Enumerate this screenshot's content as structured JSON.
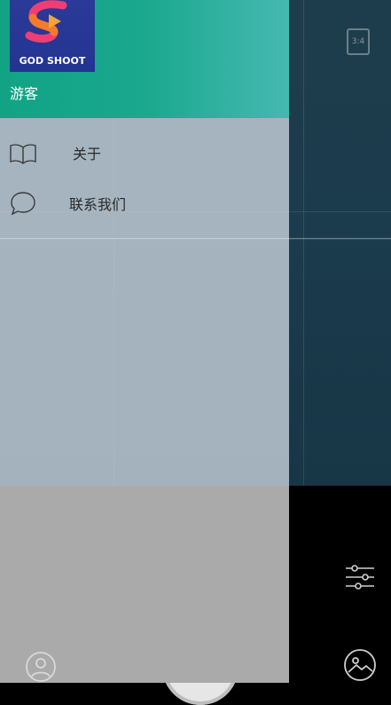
{
  "preview": {
    "aspect_ratio_label": "3:4"
  },
  "drawer": {
    "logo_text": "GOD SHOOT",
    "username": "游客",
    "menu": [
      {
        "label": "关于",
        "icon": "book-icon"
      },
      {
        "label": "联系我们",
        "icon": "chat-bubble-icon"
      }
    ]
  },
  "controls": {
    "settings_icon": "sliders-icon",
    "gallery_icon": "gallery-icon",
    "profile_icon": "user-icon",
    "shutter": "shutter-button"
  },
  "colors": {
    "header_start": "#11a384",
    "header_end": "#45b9b0",
    "logo_bg": "#2b3a98"
  }
}
